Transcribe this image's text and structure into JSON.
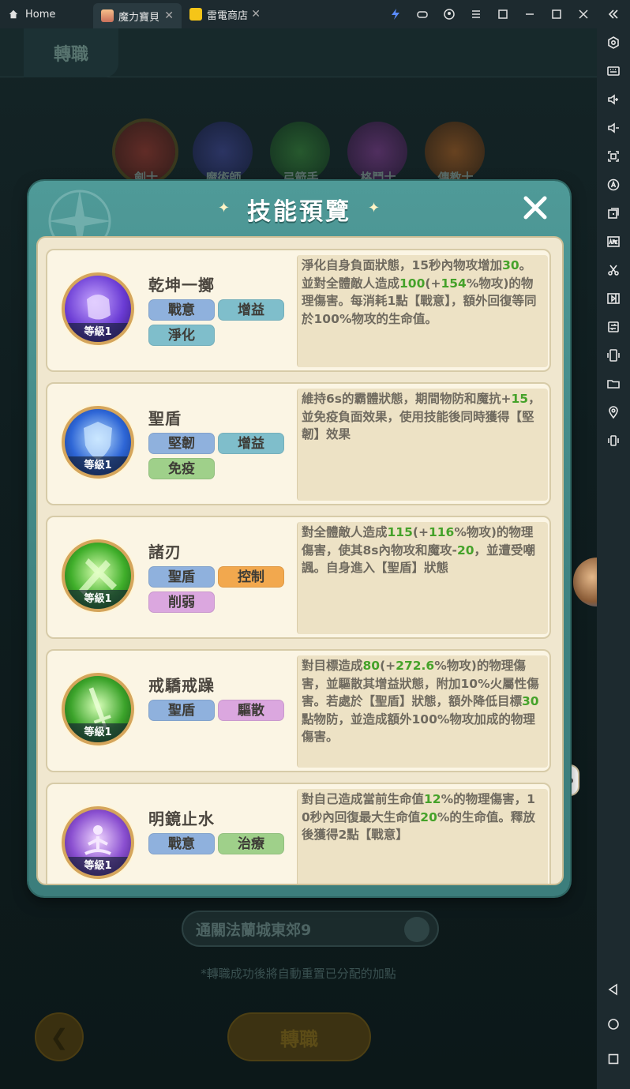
{
  "tabs": [
    {
      "label": "Home"
    },
    {
      "label": "魔力寶貝"
    },
    {
      "label": "雷電商店"
    }
  ],
  "game": {
    "page_title": "轉職",
    "classes": [
      "劍士",
      "魔術師",
      "弓箭手",
      "格鬥士",
      "傳教士"
    ],
    "requirement": "通關法蘭城東郊9",
    "note": "*轉職成功後將自動重置已分配的加點",
    "job_change_button": "轉職"
  },
  "modal": {
    "title": "技能預覽",
    "skills": [
      {
        "name": "乾坤一擲",
        "level": "等級1",
        "tags": [
          "戰意",
          "增益",
          "淨化"
        ],
        "desc": [
          "淨化自身負面狀態，15秒內物攻增加",
          "30",
          "。並對全體敵人造成",
          "100",
          "(+",
          "154",
          "%物攻)的物理傷害。每消耗1點【戰意】，額外回復等同於100%物攻的生命值。"
        ]
      },
      {
        "name": "聖盾",
        "level": "等級1",
        "tags": [
          "堅韌",
          "增益",
          "免疫"
        ],
        "desc": [
          "維持6s的霸體狀態，期間物防和魔抗+",
          "15",
          "，並免疫負面效果，使用技能後同時獲得【堅韌】效果"
        ]
      },
      {
        "name": "諸刃",
        "level": "等級1",
        "tags": [
          "聖盾",
          "控制",
          "削弱"
        ],
        "desc": [
          "對全體敵人造成",
          "115",
          "(+",
          "116",
          "%物攻)的物理傷害，使其8s內物攻和魔攻-",
          "20",
          "，並遭受嘲諷。自身進入【聖盾】狀態"
        ]
      },
      {
        "name": "戒驕戒躁",
        "level": "等級1",
        "tags": [
          "聖盾",
          "驅散"
        ],
        "desc": [
          "對目標造成",
          "80",
          "(+",
          "272.6",
          "%物攻)的物理傷害，並驅散其增益狀態，附加10%火屬性傷害。若處於【聖盾】狀態，額外降低目標",
          "30",
          "點物防，並造成額外100%物攻加成的物理傷害。"
        ]
      },
      {
        "name": "明鏡止水",
        "level": "等級1",
        "tags": [
          "戰意",
          "治療"
        ],
        "desc": [
          "對自己造成當前生命值",
          "12",
          "%的物理傷害，10秒內回復最大生命值",
          "20",
          "%的生命值。釋放後獲得2點【戰意】"
        ]
      }
    ]
  },
  "colors": {
    "modal_teal": "#4f9a98",
    "card_bg": "#fbf5e4",
    "highlight_green": "#45a22a"
  },
  "icons": {
    "sidebar": [
      "settings-icon",
      "keyboard-icon",
      "volume-up-icon",
      "volume-down-icon",
      "screenshot-icon",
      "auto-icon",
      "multi-instance-icon",
      "apk-icon",
      "scissors-icon",
      "record-icon",
      "sync-icon",
      "shake-icon",
      "folder-icon",
      "location-icon",
      "rotate-icon"
    ],
    "nav": [
      "back-icon",
      "home-icon",
      "recents-icon"
    ]
  }
}
